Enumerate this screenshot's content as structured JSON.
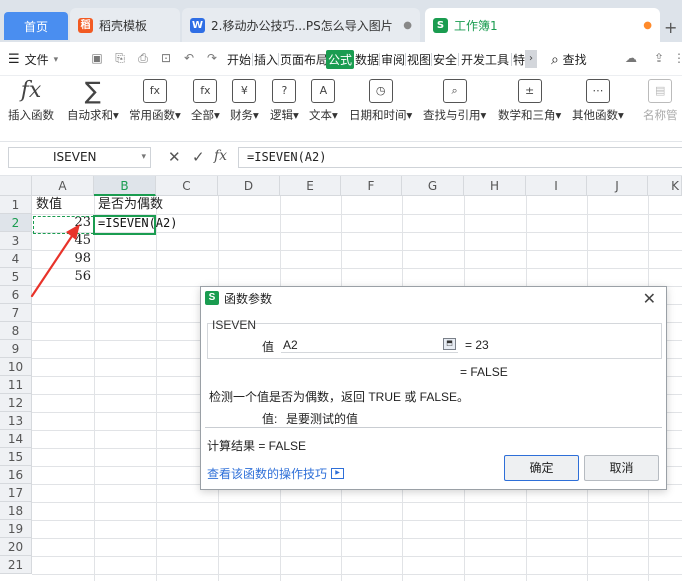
{
  "tabs": {
    "home": "首页",
    "docs": [
      {
        "label": "稻壳模板",
        "icon": "稻"
      },
      {
        "label": "2.移动办公技巧...PS怎么导入图片",
        "icon": "W",
        "close": "●"
      },
      {
        "label": "工作簿1",
        "icon": "S",
        "close": "●"
      }
    ],
    "new": "+"
  },
  "menubar": {
    "file": "文件",
    "menu_icon": "☰",
    "items": [
      "开始",
      "插入",
      "页面布局",
      "公式",
      "数据",
      "审阅",
      "视图",
      "安全",
      "开发工具",
      "特"
    ],
    "active": "公式",
    "more": "›",
    "find": "查找",
    "find_icon": "⌕"
  },
  "ribbon": {
    "items": [
      {
        "label": "插入函数",
        "icon": "fx"
      },
      {
        "label": "自动求和▾",
        "icon": "∑"
      },
      {
        "label": "常用函数▾",
        "icon": "fx"
      },
      {
        "label": "全部▾",
        "icon": "fx"
      },
      {
        "label": "财务▾",
        "icon": "¥"
      },
      {
        "label": "逻辑▾",
        "icon": "?"
      },
      {
        "label": "文本▾",
        "icon": "A"
      },
      {
        "label": "日期和时间▾",
        "icon": "◷"
      },
      {
        "label": "查找与引用▾",
        "icon": "⌕"
      },
      {
        "label": "数学和三角▾",
        "icon": "±"
      },
      {
        "label": "其他函数▾",
        "icon": "⋯"
      },
      {
        "label": "名称管",
        "icon": "▤"
      }
    ]
  },
  "formula_bar": {
    "name_box": "ISEVEN",
    "cancel": "✕",
    "confirm": "✓",
    "fx": "fx",
    "formula": "=ISEVEN(A2)"
  },
  "grid": {
    "columns": [
      "A",
      "B",
      "C",
      "D",
      "E",
      "F",
      "G",
      "H",
      "I",
      "J",
      "K"
    ],
    "rows": [
      "1",
      "2",
      "3",
      "4",
      "5",
      "6",
      "7",
      "8",
      "9",
      "10",
      "11",
      "12",
      "13",
      "14",
      "15",
      "16",
      "17",
      "18",
      "19",
      "20",
      "21"
    ],
    "cells": {
      "A1": "数值",
      "B1": "是否为偶数",
      "A2": "23",
      "B2": "=ISEVEN(A2)",
      "A3": "45",
      "A4": "98",
      "A5": "56"
    }
  },
  "dialog": {
    "title": "函数参数",
    "logo": "S",
    "close": "✕",
    "function_name": "ISEVEN",
    "arg_label": "值",
    "arg_value": "A2",
    "arg_result": "= 23",
    "fn_result": "= FALSE",
    "description": "检测一个值是否为偶数，返回 TRUE 或 FALSE。",
    "arg_desc_label": "值:",
    "arg_desc": "是要测试的值",
    "calc_result": "计算结果 = FALSE",
    "help_link": "查看该函数的操作技巧",
    "ok": "确定",
    "cancel": "取消"
  }
}
